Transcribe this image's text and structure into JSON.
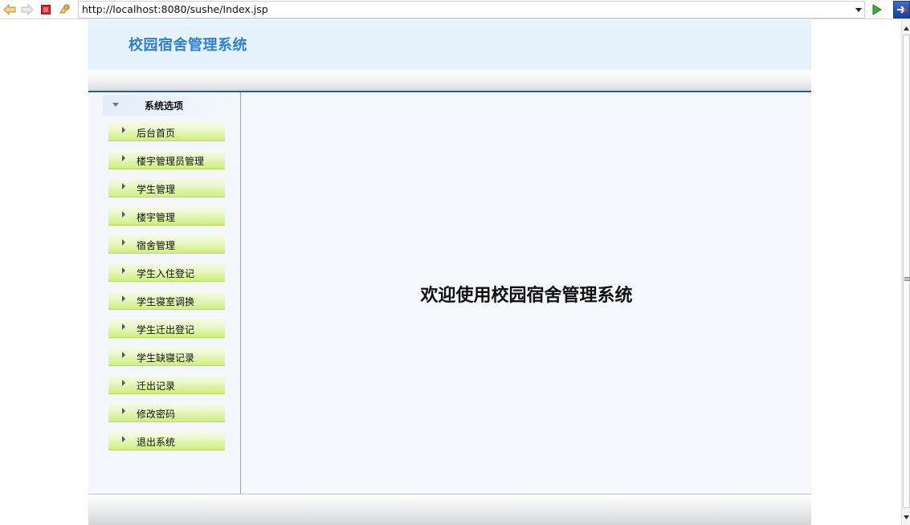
{
  "browser": {
    "url": "http://localhost:8080/sushe/Index.jsp",
    "icons": [
      "back-icon",
      "forward-icon",
      "stop-icon",
      "refresh-icon",
      "dropdown-icon",
      "go-icon",
      "extension-icon"
    ]
  },
  "header": {
    "title": "校园宿舍管理系统"
  },
  "sidebar": {
    "heading": "系统选项",
    "items": [
      {
        "label": "后台首页"
      },
      {
        "label": "楼宇管理员管理"
      },
      {
        "label": "学生管理"
      },
      {
        "label": "楼宇管理"
      },
      {
        "label": "宿舍管理"
      },
      {
        "label": "学生入住登记"
      },
      {
        "label": "学生寝室调换"
      },
      {
        "label": "学生迁出登记"
      },
      {
        "label": "学生缺寝记录"
      },
      {
        "label": "迁出记录"
      },
      {
        "label": "修改密码"
      },
      {
        "label": "退出系统"
      }
    ]
  },
  "main": {
    "welcome": "欢迎使用校园宿舍管理系统"
  },
  "colors": {
    "title_blue": "#2f7fd6",
    "banner_bg": "#e6f3fd",
    "menu_green": "#cfef7d",
    "divider_blue": "#2a5ba8"
  }
}
